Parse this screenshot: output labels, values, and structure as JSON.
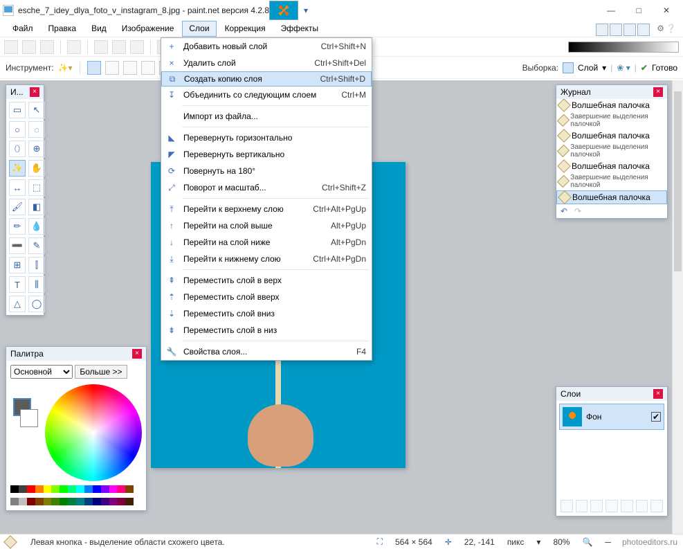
{
  "title": "esche_7_idey_dlya_foto_v_instagram_8.jpg - paint.net версия 4.2.8",
  "menubar": [
    "Файл",
    "Правка",
    "Вид",
    "Изображение",
    "Слои",
    "Коррекция",
    "Эффекты"
  ],
  "activeMenu": 4,
  "dropdown": [
    {
      "icon": "+",
      "label": "Добавить новый слой",
      "shortcut": "Ctrl+Shift+N"
    },
    {
      "icon": "×",
      "label": "Удалить слой",
      "shortcut": "Ctrl+Shift+Del"
    },
    {
      "icon": "⧉",
      "label": "Создать копию слоя",
      "shortcut": "Ctrl+Shift+D",
      "hover": true
    },
    {
      "icon": "↧",
      "label": "Объединить со следующим слоем",
      "shortcut": "Ctrl+M"
    },
    {
      "sep": true
    },
    {
      "icon": "",
      "label": "Импорт из файла...",
      "shortcut": ""
    },
    {
      "sep": true
    },
    {
      "icon": "◣",
      "label": "Перевернуть горизонтально",
      "shortcut": ""
    },
    {
      "icon": "◤",
      "label": "Перевернуть вертикально",
      "shortcut": ""
    },
    {
      "icon": "⟳",
      "label": "Повернуть на 180°",
      "shortcut": ""
    },
    {
      "icon": "⤢",
      "label": "Поворот и масштаб...",
      "shortcut": "Ctrl+Shift+Z"
    },
    {
      "sep": true
    },
    {
      "icon": "⤒",
      "label": "Перейти к верхнему слою",
      "shortcut": "Ctrl+Alt+PgUp"
    },
    {
      "icon": "↑",
      "label": "Перейти на слой выше",
      "shortcut": "Alt+PgUp"
    },
    {
      "icon": "↓",
      "label": "Перейти на слой ниже",
      "shortcut": "Alt+PgDn"
    },
    {
      "icon": "⤓",
      "label": "Перейти к нижнему слою",
      "shortcut": "Ctrl+Alt+PgDn"
    },
    {
      "sep": true
    },
    {
      "icon": "⇞",
      "label": "Переместить слой в верх",
      "shortcut": ""
    },
    {
      "icon": "⇡",
      "label": "Переместить слой вверх",
      "shortcut": ""
    },
    {
      "icon": "⇣",
      "label": "Переместить слой вниз",
      "shortcut": ""
    },
    {
      "icon": "⇟",
      "label": "Переместить слой в низ",
      "shortcut": ""
    },
    {
      "sep": true
    },
    {
      "icon": "🔧",
      "label": "Свойства слоя...",
      "shortcut": "F4"
    }
  ],
  "toolbar2": {
    "instrument_label": "Инструмент:",
    "sampling_label": "Выборка:",
    "layer_label": "Слой",
    "ready": "Готово"
  },
  "toolsPanel": {
    "title": "И..."
  },
  "toolIcons": [
    "▭",
    "↖",
    "○",
    "◌",
    "⬯",
    "⊕",
    "✨",
    "✋",
    "↔",
    "⬚",
    "🖌",
    "◧",
    "✏",
    "💧",
    "➖",
    "✎",
    "⊞",
    "⫿",
    "T",
    "⫼",
    "△",
    "◯"
  ],
  "colors": {
    "title": "Палитра",
    "mode": "Основной",
    "more": "Больше >>",
    "row1": [
      "#000",
      "#404040",
      "#ff0000",
      "#ff8000",
      "#ffff00",
      "#80ff00",
      "#00ff00",
      "#00ff80",
      "#00ffff",
      "#0080ff",
      "#0000ff",
      "#8000ff",
      "#ff00ff",
      "#ff0080",
      "#804000",
      "#ffffff"
    ],
    "row2": [
      "#808080",
      "#c0c0c0",
      "#800000",
      "#804000",
      "#808000",
      "#408000",
      "#008000",
      "#008040",
      "#008080",
      "#004080",
      "#000080",
      "#400080",
      "#800080",
      "#800040",
      "#402000",
      "#ffffff"
    ]
  },
  "history": {
    "title": "Журнал",
    "items": [
      {
        "label": "Волшебная палочка"
      },
      {
        "label": "Завершение выделения палочкой",
        "small": true
      },
      {
        "label": "Волшебная палочка"
      },
      {
        "label": "Завершение выделения палочкой",
        "small": true
      },
      {
        "label": "Волшебная палочка"
      },
      {
        "label": "Завершение выделения палочкой",
        "small": true
      },
      {
        "label": "Волшебная палочка",
        "selected": true
      }
    ]
  },
  "layers": {
    "title": "Слои",
    "items": [
      {
        "name": "Фон",
        "checked": true
      }
    ]
  },
  "status": {
    "hint": "Левая кнопка - выделение области схожего цвета.",
    "dims": "564 × 564",
    "coords": "22, -141",
    "units": "пикс",
    "zoom": "80%",
    "site": "photoeditors.ru"
  }
}
